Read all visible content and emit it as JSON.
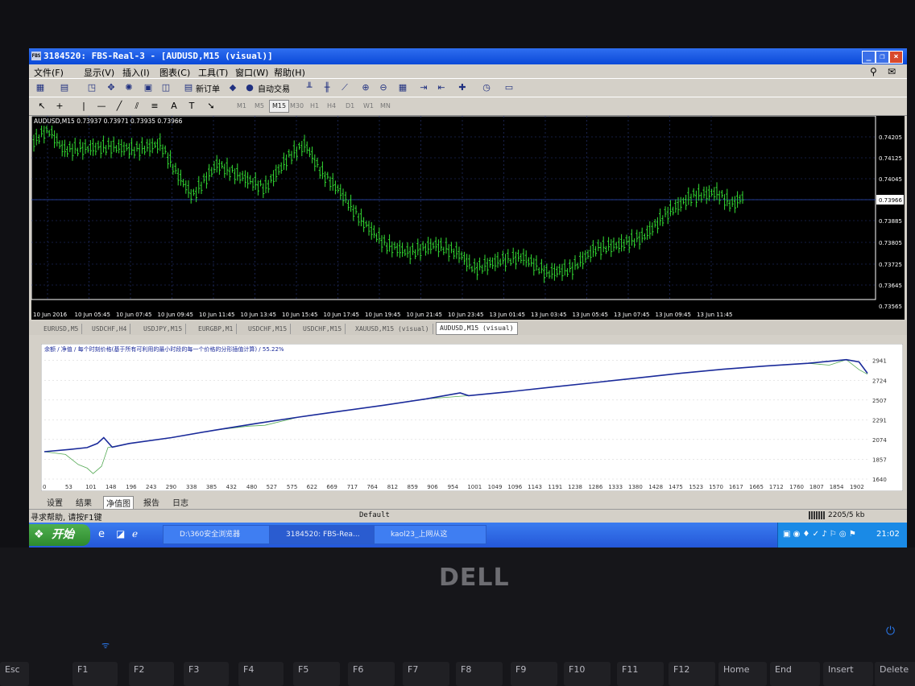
{
  "window": {
    "title": "3184520: FBS-Real-3 - [AUDUSD,M15 (visual)]",
    "app_icon_label": "FBS"
  },
  "menu": {
    "items": [
      "文件(F)",
      "显示(V)",
      "插入(I)",
      "图表(C)",
      "工具(T)",
      "窗口(W)",
      "帮助(H)"
    ]
  },
  "toolbar": {
    "new_order_label": "新订单",
    "auto_trading_label": "自动交易"
  },
  "timeframes": {
    "items": [
      "M1",
      "M5",
      "M15",
      "M30",
      "H1",
      "H4",
      "D1",
      "W1",
      "MN"
    ],
    "active": "M15"
  },
  "chart": {
    "header": "AUDUSD,M15  0.73937 0.73971 0.73935 0.73966",
    "price_levels": [
      "0.74205",
      "0.74125",
      "0.74045",
      "0.73966",
      "0.73885",
      "0.73805",
      "0.73725",
      "0.73645",
      "0.73565"
    ],
    "current_price": "0.73966",
    "time_labels": [
      "10 Jun 2016",
      "10 Jun 05:45",
      "10 Jun 07:45",
      "10 Jun 09:45",
      "10 Jun 11:45",
      "10 Jun 13:45",
      "10 Jun 15:45",
      "10 Jun 17:45",
      "10 Jun 19:45",
      "10 Jun 21:45",
      "10 Jun 23:45",
      "13 Jun 01:45",
      "13 Jun 03:45",
      "13 Jun 05:45",
      "13 Jun 07:45",
      "13 Jun 09:45",
      "13 Jun 11:45"
    ],
    "bar_color": "#33dd33",
    "grid_color": "#2a3a80",
    "price_line_color": "#3050c0"
  },
  "chart_tabs": {
    "items": [
      "EURUSD,M5",
      "USDCHF,H4",
      "USDJPY,M15",
      "EURGBP,M1",
      "USDCHF,M15",
      "USDCHF,M15",
      "XAUUSD,M15 (visual)",
      "AUDUSD,M15 (visual)"
    ],
    "active_index": 7
  },
  "tester": {
    "legend": "余额 / 净值 / 每个时刻价格(基于所有可利用的最小时段的每一个价格的分形插值计算) / 55.22%",
    "y_ticks": [
      "2941",
      "2724",
      "2507",
      "2291",
      "2074",
      "1857",
      "1640"
    ],
    "x_ticks": [
      "0",
      "53",
      "101",
      "148",
      "196",
      "243",
      "290",
      "338",
      "385",
      "432",
      "480",
      "527",
      "575",
      "622",
      "669",
      "717",
      "764",
      "812",
      "859",
      "906",
      "954",
      "1001",
      "1049",
      "1096",
      "1143",
      "1191",
      "1238",
      "1286",
      "1333",
      "1380",
      "1428",
      "1475",
      "1523",
      "1570",
      "1617",
      "1665",
      "1712",
      "1760",
      "1807",
      "1854",
      "1902"
    ],
    "balance_color": "#1a2a9a",
    "equity_color": "#55aa55",
    "tabs": [
      "设置",
      "结果",
      "净值图",
      "报告",
      "日志"
    ],
    "active_tab": "净值图"
  },
  "chart_data": {
    "type": "line",
    "title": "",
    "xlabel": "",
    "ylabel": "",
    "xlim": [
      0,
      1940
    ],
    "ylim": [
      1640,
      3000
    ],
    "series": [
      {
        "values": [
          [
            0,
            1940
          ],
          [
            60,
            1965
          ],
          [
            101,
            1985
          ],
          [
            125,
            2030
          ],
          [
            140,
            2095
          ],
          [
            160,
            1990
          ],
          [
            200,
            2030
          ],
          [
            300,
            2095
          ],
          [
            400,
            2175
          ],
          [
            500,
            2250
          ],
          [
            600,
            2320
          ],
          [
            700,
            2385
          ],
          [
            800,
            2450
          ],
          [
            900,
            2520
          ],
          [
            980,
            2585
          ],
          [
            1000,
            2555
          ],
          [
            1100,
            2600
          ],
          [
            1200,
            2650
          ],
          [
            1300,
            2700
          ],
          [
            1400,
            2750
          ],
          [
            1500,
            2800
          ],
          [
            1600,
            2845
          ],
          [
            1700,
            2880
          ],
          [
            1800,
            2910
          ],
          [
            1890,
            2950
          ],
          [
            1920,
            2925
          ],
          [
            1940,
            2800
          ]
        ]
      },
      {
        "values": [
          [
            0,
            1940
          ],
          [
            50,
            1910
          ],
          [
            80,
            1800
          ],
          [
            101,
            1760
          ],
          [
            115,
            1700
          ],
          [
            135,
            1780
          ],
          [
            150,
            1985
          ],
          [
            200,
            2030
          ],
          [
            300,
            2095
          ],
          [
            400,
            2175
          ],
          [
            480,
            2220
          ],
          [
            520,
            2230
          ],
          [
            600,
            2320
          ],
          [
            700,
            2385
          ],
          [
            800,
            2450
          ],
          [
            900,
            2520
          ],
          [
            1000,
            2555
          ],
          [
            1100,
            2600
          ],
          [
            1200,
            2650
          ],
          [
            1300,
            2700
          ],
          [
            1400,
            2750
          ],
          [
            1500,
            2800
          ],
          [
            1600,
            2845
          ],
          [
            1700,
            2880
          ],
          [
            1800,
            2910
          ],
          [
            1850,
            2890
          ],
          [
            1890,
            2950
          ],
          [
            1920,
            2840
          ],
          [
            1940,
            2790
          ]
        ]
      }
    ]
  },
  "status": {
    "help_text": "寻求帮助, 请按F1键",
    "profile": "Default",
    "traffic": "2205/5 kb"
  },
  "taskbar": {
    "start_label": "开始",
    "items": [
      "D:\\360安全浏览器",
      "3184520: FBS-Rea...",
      "kaol23_上网从这"
    ],
    "clock": "21:02"
  },
  "laptop": {
    "brand": "DELL",
    "keys": [
      "Esc",
      "F1",
      "F2",
      "F3",
      "F4",
      "F5",
      "F6",
      "F7",
      "F8",
      "F9",
      "F10",
      "F11",
      "F12",
      "Home",
      "End",
      "Insert",
      "Delete"
    ]
  }
}
